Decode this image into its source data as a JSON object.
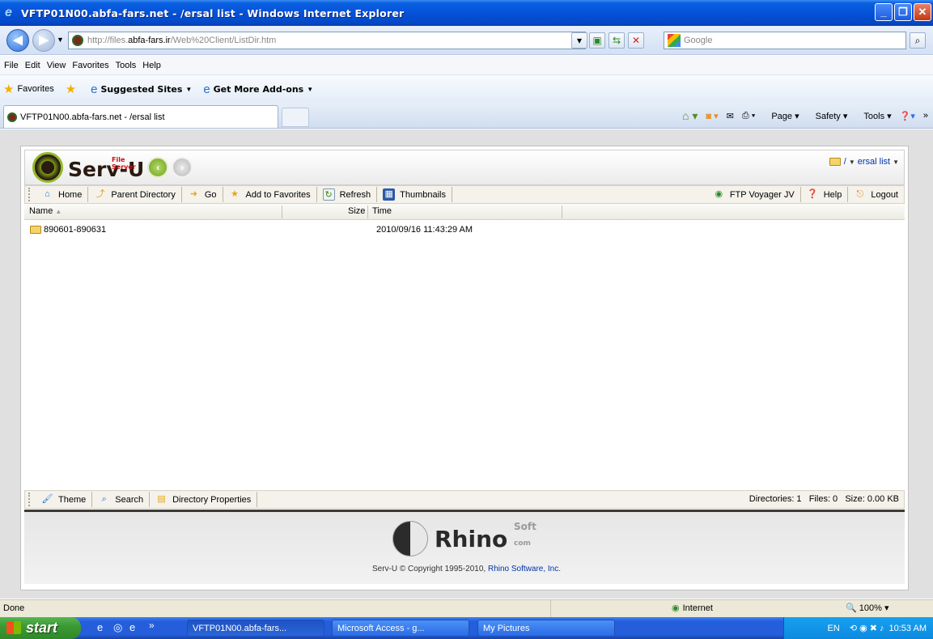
{
  "window": {
    "title": "VFTP01N00.abfa-fars.net - /ersal list - Windows Internet Explorer"
  },
  "address": {
    "url_prefix": "http://files.",
    "url_domain": "abfa-fars.ir",
    "url_path": "/Web%20Client/ListDir.htm",
    "search_placeholder": "Google"
  },
  "menu": [
    "File",
    "Edit",
    "View",
    "Favorites",
    "Tools",
    "Help"
  ],
  "favorites_bar": {
    "favorites": "Favorites",
    "suggested": "Suggested Sites",
    "addons": "Get More Add-ons"
  },
  "tab": {
    "title": "VFTP01N00.abfa-fars.net - /ersal list"
  },
  "command_bar": {
    "page": "Page",
    "safety": "Safety",
    "tools": "Tools"
  },
  "servu": {
    "brand": "Serv-U",
    "tagline": "File Server",
    "breadcrumb_root": "/",
    "breadcrumb_folder": "ersal list"
  },
  "toolbar": {
    "home": "Home",
    "parent": "Parent Directory",
    "go": "Go",
    "add_fav": "Add to Favorites",
    "refresh": "Refresh",
    "thumbnails": "Thumbnails",
    "ftp": "FTP Voyager JV",
    "help": "Help",
    "logout": "Logout"
  },
  "columns": {
    "name": "Name",
    "size": "Size",
    "time": "Time"
  },
  "files": [
    {
      "name": "890601-890631",
      "size": "",
      "time": "2010/09/16 11:43:29 AM"
    }
  ],
  "bottom_toolbar": {
    "theme": "Theme",
    "search": "Search",
    "dir_props": "Directory Properties",
    "stats": "Directories: 1   Files: 0   Size: 0.00 KB"
  },
  "footer": {
    "rhino": "Rhino",
    "soft": "Soft",
    "com": "com",
    "copyright_prefix": "Serv-U © Copyright 1995-2010, ",
    "copyright_link": "Rhino Software, Inc."
  },
  "status": {
    "left": "Done",
    "zone": "Internet",
    "zoom": "100%"
  },
  "taskbar": {
    "start": "start",
    "tasks": [
      "VFTP01N00.abfa-fars...",
      "Microsoft Access - g...",
      "My Pictures"
    ],
    "lang": "EN",
    "clock": "10:53 AM"
  }
}
